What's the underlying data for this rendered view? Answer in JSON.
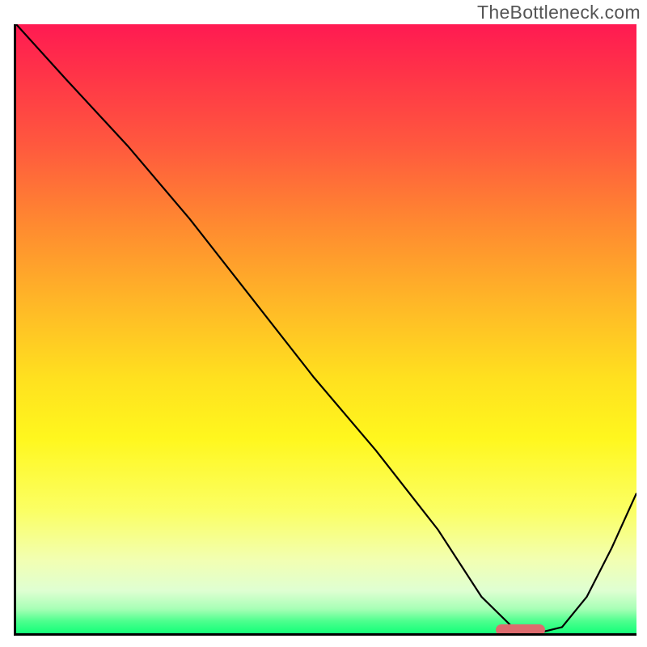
{
  "watermark": "TheBottleneck.com",
  "colors": {
    "axis": "#000000",
    "curve": "#000000",
    "marker": "#dd6b6e",
    "gradient_top": "#ff1a52",
    "gradient_bottom": "#14ff79"
  },
  "chart_data": {
    "type": "line",
    "title": "",
    "xlabel": "",
    "ylabel": "",
    "xlim": [
      0,
      100
    ],
    "ylim": [
      0,
      100
    ],
    "series": [
      {
        "name": "bottleneck-curve",
        "x": [
          0,
          8,
          18,
          28,
          38,
          48,
          58,
          68,
          75,
          80,
          84,
          88,
          92,
          96,
          100
        ],
        "values": [
          100,
          91,
          80,
          68,
          55,
          42,
          30,
          17,
          6,
          1,
          0,
          1,
          6,
          14,
          23
        ]
      }
    ],
    "marker": {
      "x_start": 77,
      "x_end": 85,
      "y": 0.5
    }
  }
}
